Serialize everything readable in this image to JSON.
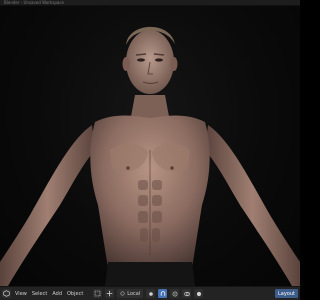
{
  "title_bar": {
    "text": "Blender - Unsaved Workspace"
  },
  "viewport": {
    "background": "#0a0a0a",
    "skin_color": "#a88878"
  },
  "header": {
    "editor_icon": "view3d-icon",
    "menus": [
      "View",
      "Select",
      "Add",
      "Object"
    ],
    "orientation": "Local",
    "tab_right": "Layout",
    "accent": "#4772b3"
  }
}
